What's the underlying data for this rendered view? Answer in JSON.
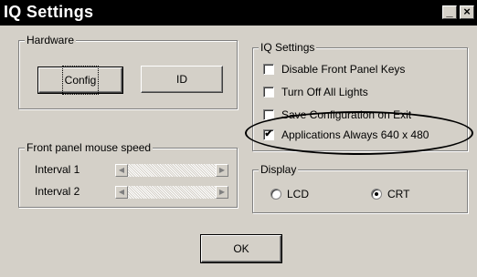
{
  "window": {
    "title": "IQ Settings",
    "minimize_glyph": "_",
    "close_glyph": "×"
  },
  "hardware": {
    "legend": "Hardware",
    "config_button": "Config",
    "id_button": "ID"
  },
  "iq_settings": {
    "legend": "IQ Settings",
    "options": [
      {
        "label": "Disable Front Panel Keys",
        "checked": false
      },
      {
        "label": "Turn Off All Lights",
        "checked": false
      },
      {
        "label": "Save Configuration on Exit",
        "checked": false
      },
      {
        "label": "Applications Always 640 x 480",
        "checked": true
      }
    ]
  },
  "mouse_speed": {
    "legend": "Front panel mouse speed",
    "interval1_label": "Interval 1",
    "interval2_label": "Interval 2"
  },
  "display": {
    "legend": "Display",
    "options": [
      {
        "label": "LCD",
        "selected": false
      },
      {
        "label": "CRT",
        "selected": true
      }
    ]
  },
  "footer": {
    "ok_button": "OK"
  },
  "icons": {
    "check_mark": "✔",
    "left_arrow": "◀",
    "right_arrow": "▶"
  }
}
